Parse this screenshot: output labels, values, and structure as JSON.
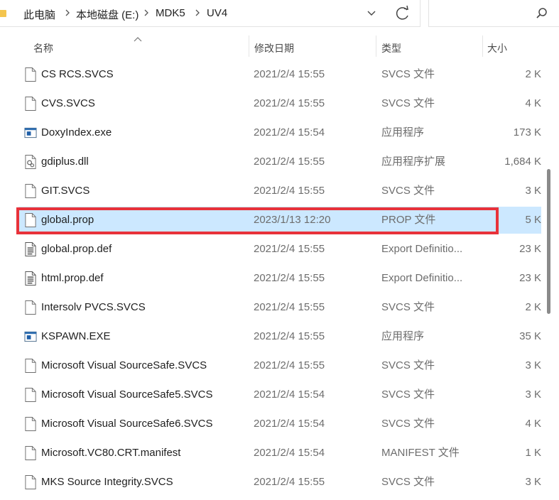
{
  "address_bar": {
    "crumbs": [
      "此电脑",
      "本地磁盘 (E:)",
      "MDK5",
      "UV4"
    ]
  },
  "columns": {
    "name": "名称",
    "date": "修改日期",
    "type": "类型",
    "size": "大小"
  },
  "rows": [
    {
      "name": "CS RCS.SVCS",
      "date": "2021/2/4 15:55",
      "type": "SVCS 文件",
      "size": "2 K",
      "icon": "blank-file-icon"
    },
    {
      "name": "CVS.SVCS",
      "date": "2021/2/4 15:55",
      "type": "SVCS 文件",
      "size": "4 K",
      "icon": "blank-file-icon"
    },
    {
      "name": "DoxyIndex.exe",
      "date": "2021/2/4 15:54",
      "type": "应用程序",
      "size": "173 K",
      "icon": "exe-icon"
    },
    {
      "name": "gdiplus.dll",
      "date": "2021/2/4 15:55",
      "type": "应用程序扩展",
      "size": "1,684 K",
      "icon": "dll-icon"
    },
    {
      "name": "GIT.SVCS",
      "date": "2021/2/4 15:55",
      "type": "SVCS 文件",
      "size": "3 K",
      "icon": "blank-file-icon"
    },
    {
      "name": "global.prop",
      "date": "2023/1/13 12:20",
      "type": "PROP 文件",
      "size": "5 K",
      "icon": "blank-file-icon",
      "selected": true
    },
    {
      "name": "global.prop.def",
      "date": "2021/2/4 15:55",
      "type": "Export Definitio...",
      "size": "23 K",
      "icon": "text-file-icon"
    },
    {
      "name": "html.prop.def",
      "date": "2021/2/4 15:55",
      "type": "Export Definitio...",
      "size": "23 K",
      "icon": "text-file-icon"
    },
    {
      "name": "Intersolv PVCS.SVCS",
      "date": "2021/2/4 15:55",
      "type": "SVCS 文件",
      "size": "2 K",
      "icon": "blank-file-icon"
    },
    {
      "name": "KSPAWN.EXE",
      "date": "2021/2/4 15:55",
      "type": "应用程序",
      "size": "35 K",
      "icon": "exe-icon"
    },
    {
      "name": "Microsoft Visual SourceSafe.SVCS",
      "date": "2021/2/4 15:55",
      "type": "SVCS 文件",
      "size": "3 K",
      "icon": "blank-file-icon"
    },
    {
      "name": "Microsoft Visual SourceSafe5.SVCS",
      "date": "2021/2/4 15:54",
      "type": "SVCS 文件",
      "size": "3 K",
      "icon": "blank-file-icon"
    },
    {
      "name": "Microsoft Visual SourceSafe6.SVCS",
      "date": "2021/2/4 15:54",
      "type": "SVCS 文件",
      "size": "4 K",
      "icon": "blank-file-icon"
    },
    {
      "name": "Microsoft.VC80.CRT.manifest",
      "date": "2021/2/4 15:54",
      "type": "MANIFEST 文件",
      "size": "1 K",
      "icon": "blank-file-icon"
    },
    {
      "name": "MKS Source Integrity.SVCS",
      "date": "2021/2/4 15:55",
      "type": "SVCS 文件",
      "size": "3 K",
      "icon": "blank-file-icon"
    }
  ],
  "colors": {
    "selection": "#cce8ff",
    "highlight_border": "#e8323a"
  }
}
